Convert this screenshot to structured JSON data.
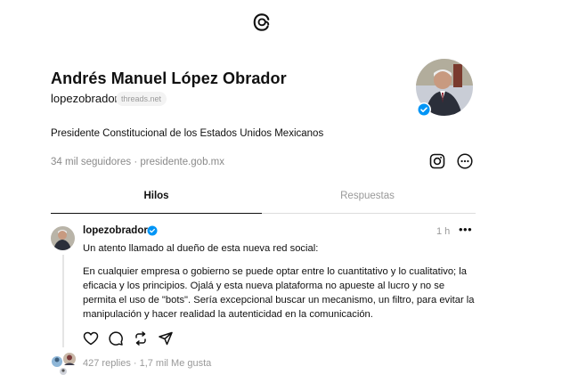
{
  "header": {
    "logo_icon": "threads-logo-icon"
  },
  "profile": {
    "name": "Andrés Manuel López Obrador",
    "handle": "lopezobrador",
    "domain_chip": "threads.net",
    "bio": "Presidente Constitucional de los Estados Unidos Mexicanos",
    "followers": "34 mil seguidores",
    "separator": "·",
    "link": "presidente.gob.mx"
  },
  "tabs": [
    {
      "label": "Hilos",
      "active": true
    },
    {
      "label": "Respuestas",
      "active": false
    }
  ],
  "post": {
    "username": "lopezobrador",
    "time": "1 h",
    "more": "•••",
    "paragraph1": "Un atento llamado al dueño de esta nueva red social:",
    "paragraph2": "En cualquier empresa o gobierno se puede optar entre lo cuantitativo y lo cualitativo; la eficacia y los principios. Ojalá y esta nueva plataforma no apueste al lucro y no se permita el uso de \"bots\". Sería excepcional buscar un mecanismo, un filtro, para evitar la manipulación y hacer realidad la autenticidad en la comunicación.",
    "stats": "427 replies · 1,7 mil Me gusta",
    "actions": [
      "heart-icon",
      "comment-icon",
      "repost-icon",
      "share-icon"
    ]
  },
  "colors": {
    "text": "#101010",
    "muted": "#999999",
    "verified": "#0095f6"
  }
}
